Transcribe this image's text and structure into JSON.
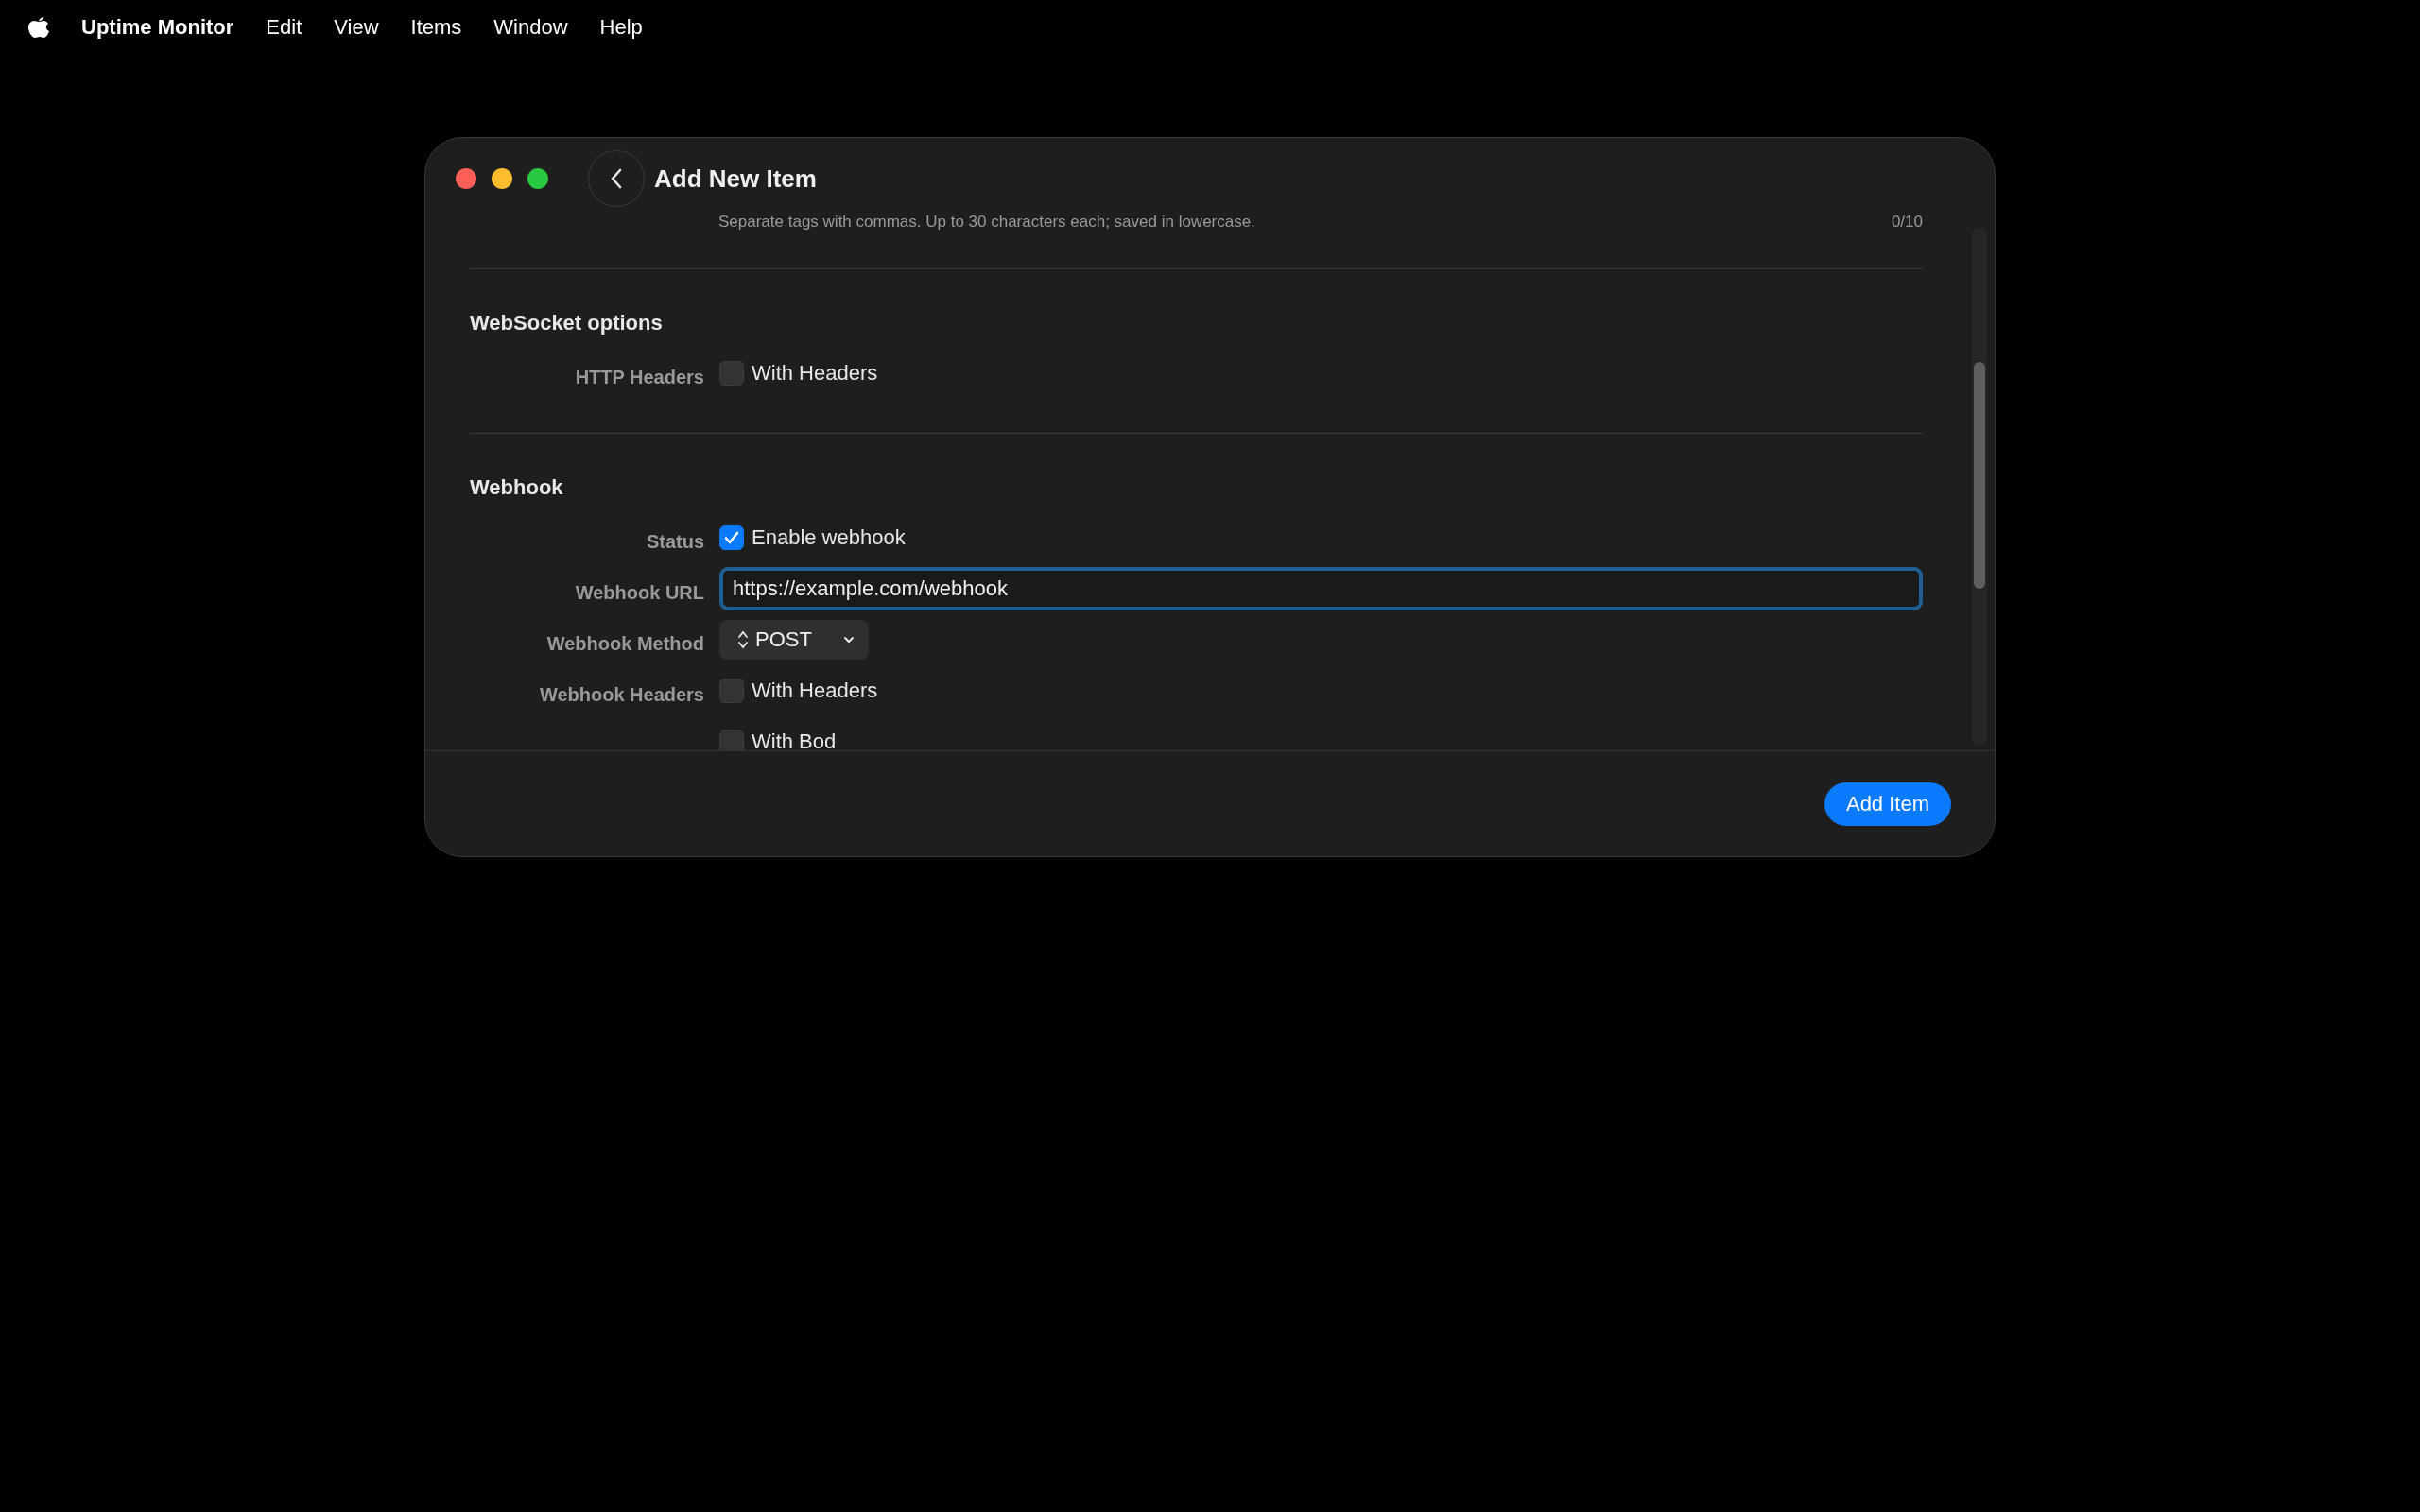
{
  "menu_bar": {
    "app_name": "Uptime Monitor",
    "items": [
      "Edit",
      "View",
      "Items",
      "Window",
      "Help"
    ]
  },
  "window": {
    "title": "Add New Item"
  },
  "tags_hint": {
    "text": "Separate tags with commas. Up to 30 characters each; saved in lowercase.",
    "count": "0/10"
  },
  "sections": [
    {
      "title": "WebSocket options",
      "rows": [
        {
          "kind": "checkbox",
          "label": "HTTP Headers",
          "text": "With Headers",
          "checked": false
        }
      ]
    },
    {
      "title": "Webhook",
      "rows": [
        {
          "kind": "checkbox",
          "label": "Status",
          "text": "Enable webhook",
          "checked": true
        },
        {
          "kind": "text",
          "label": "Webhook URL",
          "value": "https://example.com/webhook",
          "focused": true
        },
        {
          "kind": "select",
          "label": "Webhook Method",
          "value": "POST"
        },
        {
          "kind": "checkbox",
          "label": "Webhook Headers",
          "text": "With Headers",
          "checked": false
        },
        {
          "kind": "checkbox",
          "text": "With Bod",
          "checked": false
        }
      ]
    }
  ],
  "footer": {
    "button": "Add Item"
  }
}
